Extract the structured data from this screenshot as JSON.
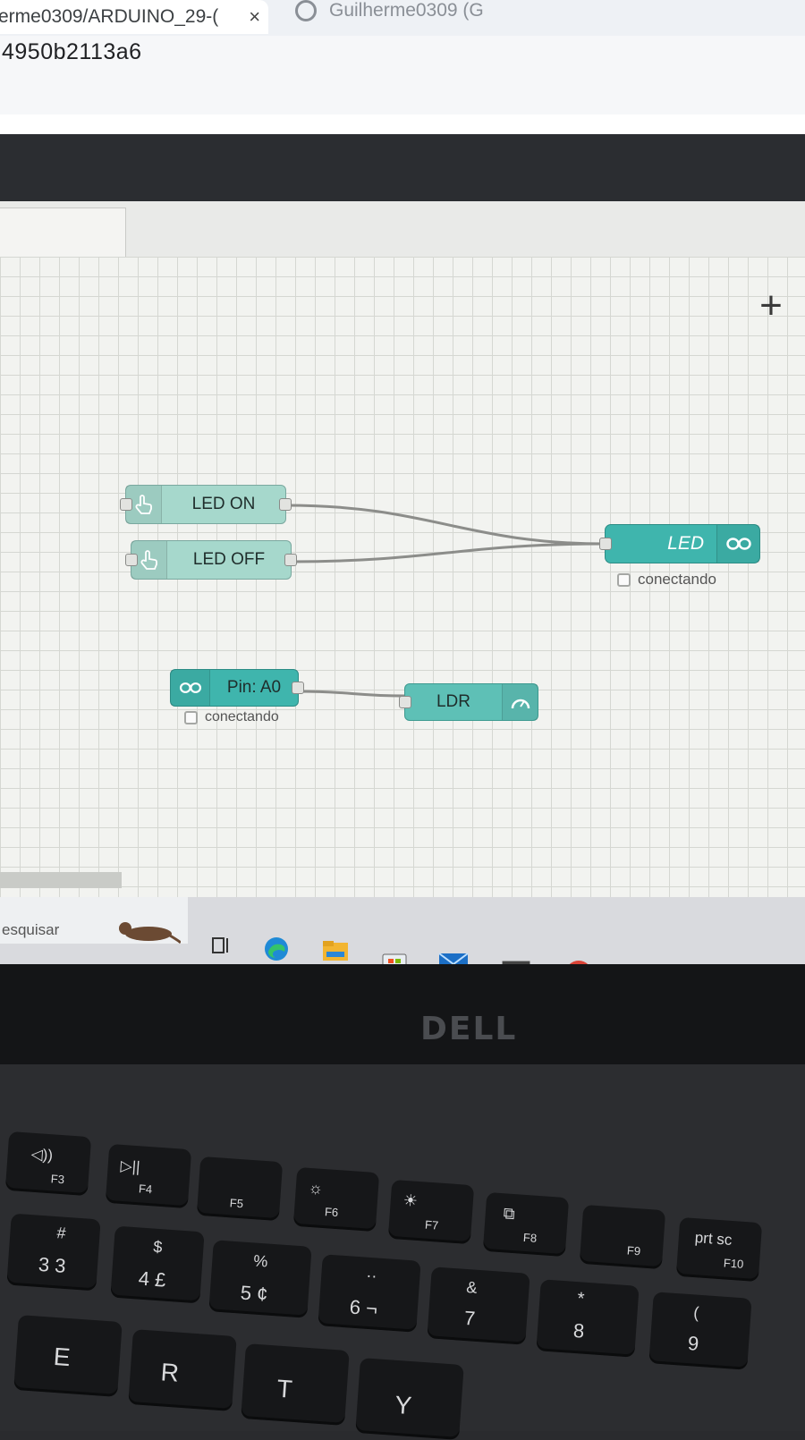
{
  "browser": {
    "tab_title": "erme0309/ARDUINO_29-(",
    "tab_close": "×",
    "second_tab_title": "Guilherme0309 (G",
    "address": "4950b2113a6"
  },
  "canvas": {
    "zoom_plus": "+",
    "nodes": {
      "led_on": {
        "label": "LED ON",
        "icon": "hand-pointer-icon"
      },
      "led_off": {
        "label": "LED OFF",
        "icon": "hand-pointer-icon"
      },
      "led_out": {
        "label": "LED",
        "icon": "arduino-icon",
        "status": "conectando"
      },
      "pin_a0": {
        "label": "Pin: A0",
        "icon": "arduino-icon",
        "status": "conectando"
      },
      "ldr": {
        "label": "LDR",
        "icon": "gauge-icon"
      }
    },
    "colors": {
      "inject_node": "#a6d8cc",
      "arduino_node": "#3fb5ad",
      "wire": "#8c8d8a",
      "grid_bg": "#f2f3f0"
    }
  },
  "taskbar": {
    "search_text": "esquisar",
    "apps": [
      "task-view-icon",
      "edge-icon",
      "file-explorer-icon",
      "store-icon",
      "mail-icon",
      "terminal-icon",
      "chrome-icon"
    ]
  },
  "laptop": {
    "brand": "DELL"
  },
  "keyboard": {
    "keys": [
      {
        "main": "◁))",
        "sub": "F3"
      },
      {
        "main": "▷||",
        "sub": "F4"
      },
      {
        "main": "",
        "sub": "F5"
      },
      {
        "main": "☼",
        "sub": "F6"
      },
      {
        "main": "☀",
        "sub": "F7"
      },
      {
        "main": "⧉",
        "sub": "F8"
      },
      {
        "main": "",
        "sub": "F9"
      },
      {
        "main": "prt sc",
        "sub": "F10"
      },
      {
        "main": "#",
        "sub": "3 3"
      },
      {
        "main": "$",
        "sub": "4 £"
      },
      {
        "main": "%",
        "sub": "5 ¢"
      },
      {
        "main": "··",
        "sub": "6 ¬"
      },
      {
        "main": "&",
        "sub": "7"
      },
      {
        "main": "*",
        "sub": "8"
      },
      {
        "main": "(",
        "sub": "9"
      },
      {
        "main": "E",
        "sub": ""
      },
      {
        "main": "R",
        "sub": ""
      },
      {
        "main": "T",
        "sub": ""
      },
      {
        "main": "Y",
        "sub": ""
      }
    ]
  }
}
